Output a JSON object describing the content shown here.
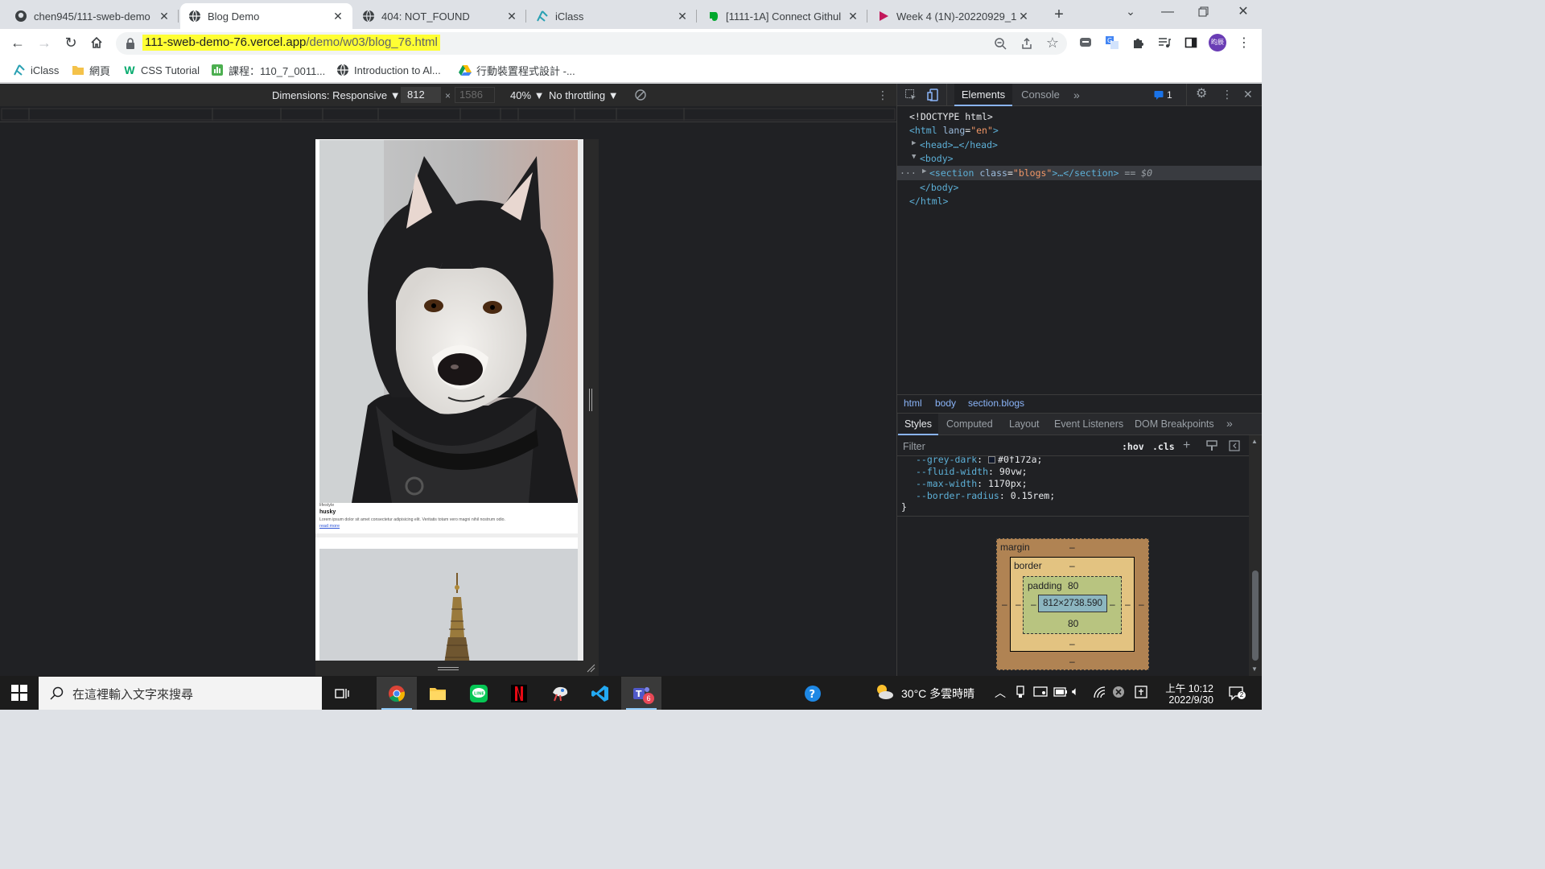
{
  "tabs": [
    {
      "title": "chen945/111-sweb-demo",
      "icon": "github-icon"
    },
    {
      "title": "Blog Demo",
      "icon": "globe-icon"
    },
    {
      "title": "404: NOT_FOUND",
      "icon": "globe-icon"
    },
    {
      "title": "iClass",
      "icon": "iclass-icon"
    },
    {
      "title": "[1111-1A] Connect Githul",
      "icon": "evernote-icon"
    },
    {
      "title": "Week 4 (1N)-20220929_1",
      "icon": "play-icon"
    }
  ],
  "address": {
    "host": "111-sweb-demo-76.vercel.app",
    "path": "/demo/w03/blog_76.html"
  },
  "profile": {
    "initials": "昀辰"
  },
  "bookmarks": [
    "iClass",
    "網頁",
    "CSS Tutorial",
    "課程：110_7_0011...",
    "Introduction to Al...",
    "行動裝置程式設計 -..."
  ],
  "device_toolbar": {
    "dimensions_label": "Dimensions: Responsive",
    "width": "812",
    "height": "1586",
    "zoom": "40%",
    "throttling": "No throttling"
  },
  "blog": {
    "category": "lifestyle",
    "title": "husky",
    "text": "Lorem ipsum dolor sit amet consectetur adipisicing elit. Veritatis totam vero magni nihil nostrum odio.",
    "link": "read more"
  },
  "devtools": {
    "tabs": [
      "Elements",
      "Console"
    ],
    "issues_count": "1",
    "dom": {
      "doctype": "<!DOCTYPE html>",
      "html_open": "<html",
      "lang_attr": "lang",
      "lang_val": "\"en\"",
      "head": "<head>…</head>",
      "body_open": "<body>",
      "section_open": "<section",
      "class_attr": "class",
      "class_val": "\"blogs\"",
      "section_rest": ">…</section>",
      "selected_marker": "== $0",
      "body_close": "</body>",
      "html_close": "</html>"
    },
    "breadcrumbs": [
      "html",
      "body",
      "section.blogs"
    ],
    "style_tabs": [
      "Styles",
      "Computed",
      "Layout",
      "Event Listeners",
      "DOM Breakpoints"
    ],
    "filter_placeholder": "Filter",
    "filter_buttons": [
      ":hov",
      ".cls"
    ],
    "css_vars": [
      {
        "name": "--grey-dark",
        "value": "#0f172a"
      },
      {
        "name": "--fluid-width",
        "value": "90vw"
      },
      {
        "name": "--max-width",
        "value": "1170px"
      },
      {
        "name": "--border-radius",
        "value": "0.15rem"
      }
    ],
    "box_model": {
      "margin_label": "margin",
      "border_label": "border",
      "padding_label": "padding",
      "padding_top": "80",
      "padding_bottom": "80",
      "content": "812×2738.590",
      "dash": "–"
    }
  },
  "taskbar": {
    "search_placeholder": "在這裡輸入文字來搜尋",
    "weather": "30°C 多雲時晴",
    "time": "上午 10:12",
    "date": "2022/9/30",
    "teams_badge": "6",
    "notification_badge": "2"
  }
}
